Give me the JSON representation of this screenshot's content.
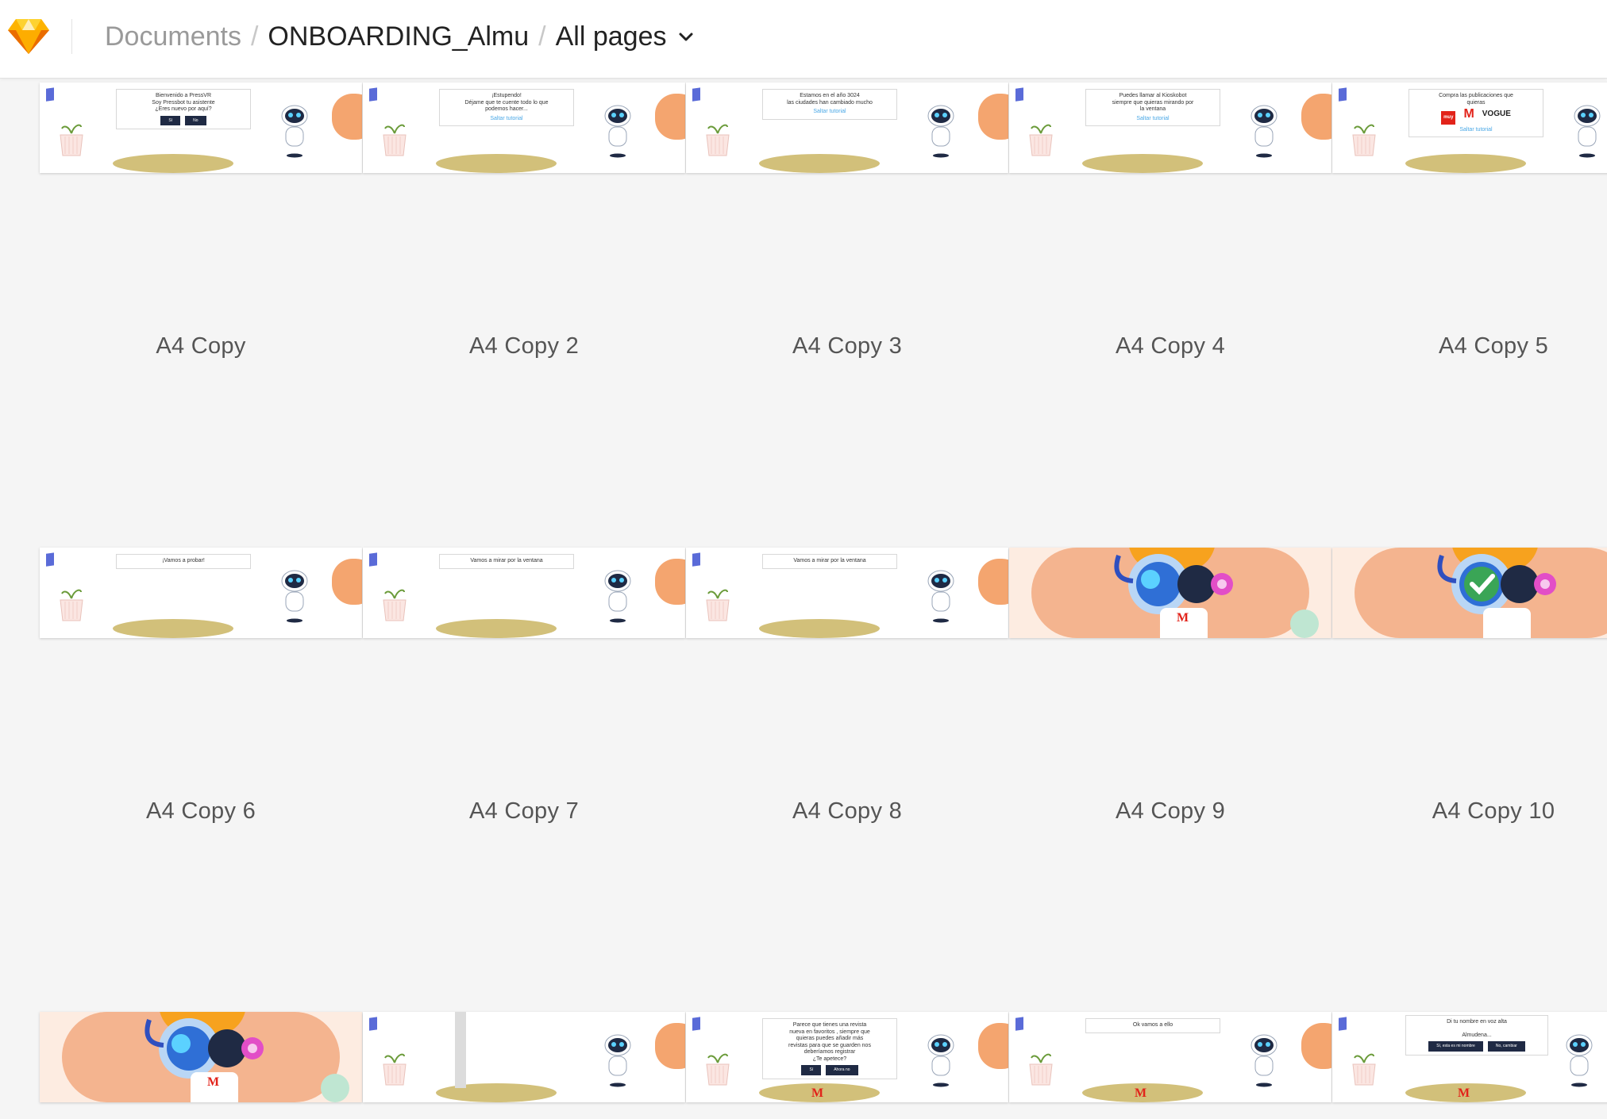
{
  "header": {
    "breadcrumb_root": "Documents",
    "breadcrumb_document": "ONBOARDING_Almu",
    "breadcrumb_pages": "All pages"
  },
  "colors": {
    "accent": "#f7a21e",
    "floor": "#d2c07a",
    "robot_dark": "#1f2a44",
    "robot_blue": "#3b8fe0",
    "peach": "#f4b48f",
    "link": "#4aa8e6",
    "brand_red": "#e2231a"
  },
  "artboards": [
    {
      "label": "A4 Copy",
      "scene": "room",
      "bubble": {
        "lines": [
          "Bienvenido a PressVR",
          "Soy Pressbot tu asistente",
          "¿Eres nuevo por aquí?"
        ],
        "buttons": [
          "Sí",
          "No"
        ]
      }
    },
    {
      "label": "A4 Copy 2",
      "scene": "room",
      "bubble": {
        "lines": [
          "¡Estupendo!",
          "Déjame que te cuente todo lo que",
          "podemos hacer..."
        ],
        "skip": "Saltar tutorial"
      }
    },
    {
      "label": "A4 Copy 3",
      "scene": "room",
      "bubble": {
        "lines": [
          "Estamos en el año 3024",
          "las ciudades han cambiado mucho"
        ],
        "skip": "Saltar tutorial"
      }
    },
    {
      "label": "A4 Copy 4",
      "scene": "room",
      "bubble": {
        "lines": [
          "Puedes llamar al Kioskobot",
          "siempre que quieras mirando por",
          "la ventana"
        ],
        "skip": "Saltar tutorial"
      }
    },
    {
      "label": "A4 Copy 5",
      "scene": "room",
      "bubble": {
        "lines": [
          "Compra las publicaciones que",
          "quieras"
        ],
        "logos": [
          "muy",
          "M",
          "VOGUE"
        ],
        "skip": "Saltar tutorial"
      }
    },
    {
      "label": "A4 Copy 6",
      "scene": "room",
      "bubble": {
        "lines": [
          "¡Vamos a probar!"
        ]
      }
    },
    {
      "label": "A4 Copy 7",
      "scene": "room",
      "bubble": {
        "lines": [
          "Vamos a mirar por la ventana"
        ]
      }
    },
    {
      "label": "A4 Copy 8",
      "scene": "room",
      "bubble": {
        "lines": [
          "Vamos a mirar por la ventana"
        ]
      }
    },
    {
      "label": "A4 Copy 9",
      "scene": "kiosk",
      "badge": "M"
    },
    {
      "label": "A4 Copy 10",
      "scene": "kiosk-check"
    },
    {
      "label": "",
      "scene": "kiosk",
      "badge": "M"
    },
    {
      "label": "",
      "scene": "room-pole"
    },
    {
      "label": "",
      "scene": "room",
      "bubble": {
        "lines": [
          "Parece que tienes una revista",
          "nueva en favoritos , siempre que",
          "quieras puedes añadir más",
          "revistas para que se guarden nos",
          "deberíamos registrar",
          "¿Te apetece?"
        ],
        "buttons": [
          "Sí",
          "Ahora no"
        ]
      },
      "badge": "M"
    },
    {
      "label": "",
      "scene": "room",
      "bubble": {
        "lines": [
          "Ok vamos a ello"
        ]
      },
      "badge": "M"
    },
    {
      "label": "",
      "scene": "room-voice",
      "bubble": {
        "lines": [
          "Di tu nombre en voz alta",
          "",
          "Almudena..."
        ],
        "buttons": [
          "Sí, esta es mi nombre",
          "No, cambiar"
        ]
      },
      "badge": "M"
    }
  ]
}
